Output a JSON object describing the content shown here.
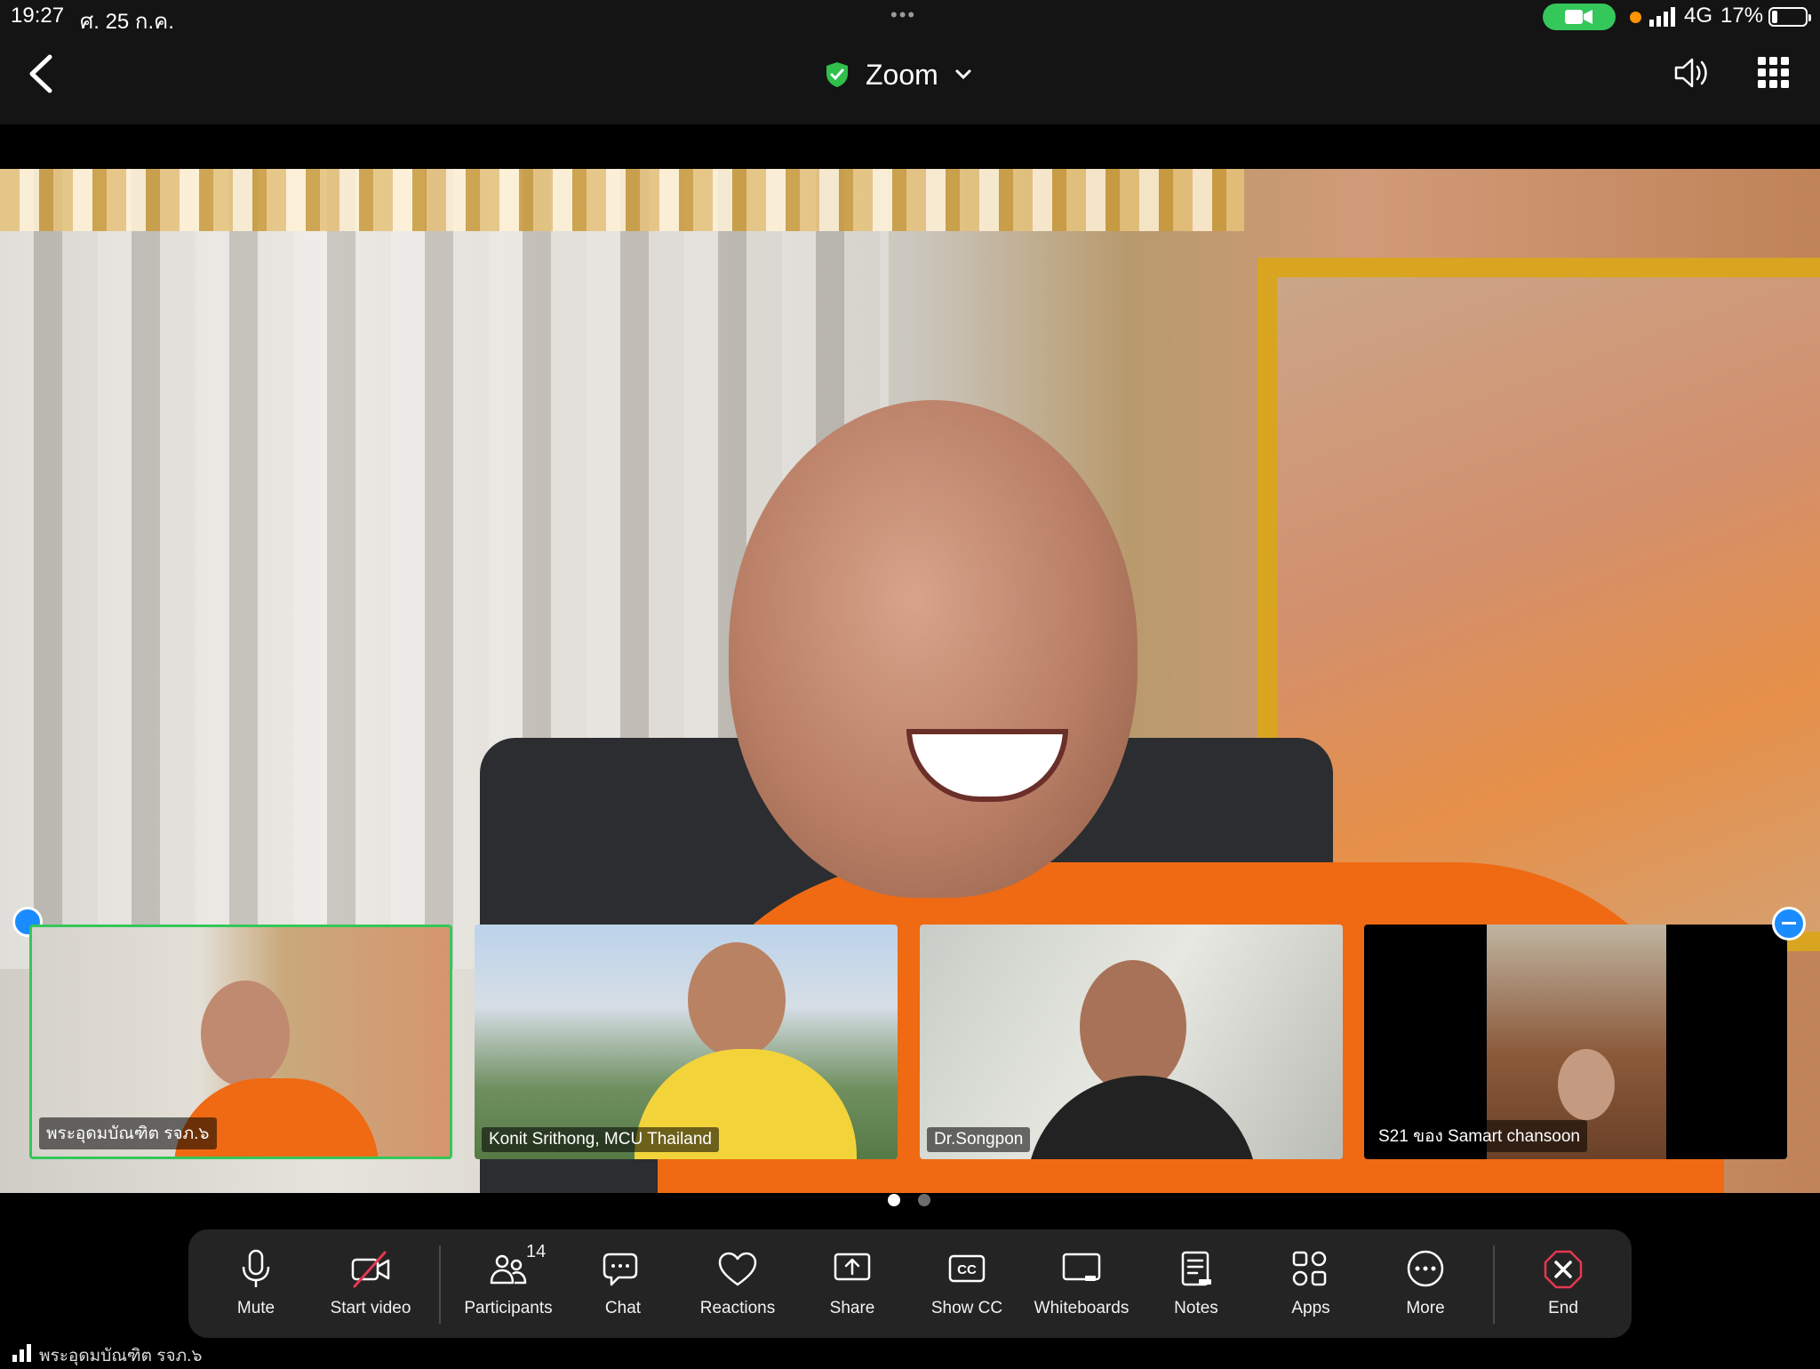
{
  "status_bar": {
    "time": "19:27",
    "date": "ศ. 25 ก.ค.",
    "network": "4G",
    "battery": "17%",
    "battery_level": 0.17
  },
  "header": {
    "title": "Zoom",
    "icons": [
      "chevron-left-icon",
      "shield-check-icon",
      "chevron-down-icon",
      "speaker-icon",
      "grid-icon"
    ]
  },
  "participants": [
    {
      "name": "พระอุดมบัณฑิต รจภ.๖",
      "active": true
    },
    {
      "name": "Konit Srithong, MCU Thailand",
      "active": false
    },
    {
      "name": "Dr.Songpon",
      "active": false
    },
    {
      "name": "S21 ของ Samart  chansoon",
      "active": false
    }
  ],
  "pager": {
    "pages": 2,
    "current": 1
  },
  "toolbar": {
    "mute": "Mute",
    "start_video": "Start video",
    "participants": "Participants",
    "participants_count": "14",
    "chat": "Chat",
    "reactions": "Reactions",
    "share": "Share",
    "show_cc": "Show CC",
    "whiteboards": "Whiteboards",
    "notes": "Notes",
    "apps": "Apps",
    "more": "More",
    "end": "End"
  },
  "colors": {
    "active_border": "#34c759",
    "accent": "#1a8cff",
    "end": "#e8374f",
    "toolbar_bg": "#242424"
  },
  "footer": {
    "speaker_name": "พระอุดมบัณฑิต รจภ.๖"
  }
}
